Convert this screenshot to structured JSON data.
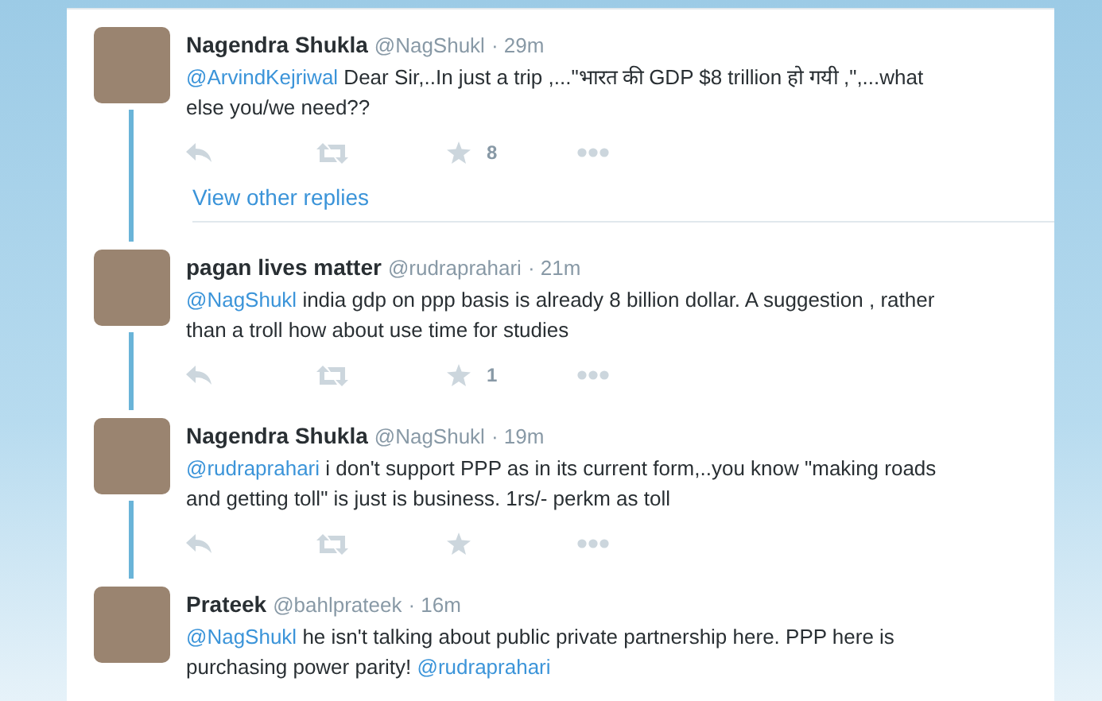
{
  "tweets": [
    {
      "name": "Nagendra Shukla",
      "handle": "@NagShukl",
      "time": "· 29m",
      "segments": [
        {
          "kind": "mention",
          "text": "@ArvindKejriwal"
        },
        {
          "kind": "text",
          "text": " Dear Sir,..In just a trip ,...\"भारत की GDP $8 trillion हो गयी ,\",...what else you/we need??"
        }
      ],
      "favorites": "8",
      "show_actions": true,
      "more_replies": "View other replies",
      "thread_line": true
    },
    {
      "name": "pagan lives matter",
      "handle": "@rudraprahari",
      "time": "· 21m",
      "segments": [
        {
          "kind": "mention",
          "text": "@NagShukl"
        },
        {
          "kind": "text",
          "text": " india gdp on ppp basis is already 8 billion dollar.  A suggestion , rather than a troll how about use time for studies"
        }
      ],
      "favorites": "1",
      "show_actions": true,
      "thread_line": true
    },
    {
      "name": "Nagendra Shukla",
      "handle": "@NagShukl",
      "time": "· 19m",
      "segments": [
        {
          "kind": "mention",
          "text": "@rudraprahari"
        },
        {
          "kind": "text",
          "text": " i don't support PPP as in its current form,..you know \"making roads and getting toll\" is just is business. 1rs/- perkm as toll"
        }
      ],
      "show_actions": true,
      "thread_line": true
    },
    {
      "name": "Prateek",
      "handle": "@bahlprateek",
      "time": "· 16m",
      "segments": [
        {
          "kind": "mention",
          "text": "@NagShukl"
        },
        {
          "kind": "text",
          "text": " he isn't talking about public private partnership here. PPP here is purchasing power parity! "
        },
        {
          "kind": "mention",
          "text": "@rudraprahari"
        }
      ],
      "show_actions": false,
      "thread_line": false
    }
  ]
}
